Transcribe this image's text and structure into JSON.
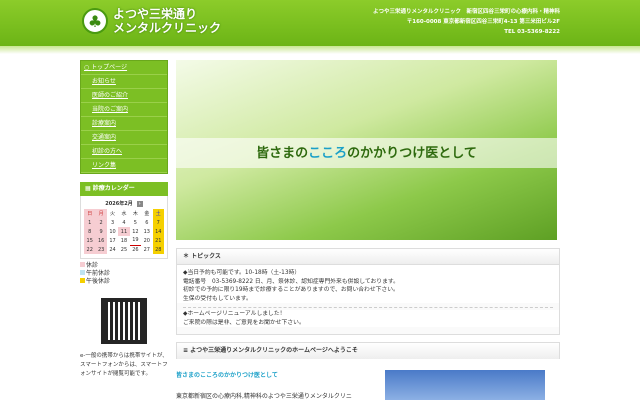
{
  "header": {
    "logo_line1": "よつや三栄通り",
    "logo_line2": "メンタルクリニック",
    "tagline": "よつや三栄通りメンタルクリニック　新宿区四谷三栄町の心療内科・精神科",
    "address": "〒160-0008 東京都新宿区四谷三栄町4-13 第三米田ビル2F",
    "tel": "TEL 03-5369-8222"
  },
  "nav": [
    "トップページ",
    "お知らせ",
    "医師のご紹介",
    "当院のご案内",
    "診療案内",
    "交通案内",
    "初診の方へ",
    "リンク集"
  ],
  "calendar": {
    "title": "診療カレンダー",
    "month": "2026年2月",
    "next": "›",
    "weekdays": [
      "日",
      "月",
      "火",
      "水",
      "木",
      "金",
      "土"
    ],
    "weeks": [
      [
        "1",
        "2",
        "3",
        "4",
        "5",
        "6",
        "7"
      ],
      [
        "8",
        "9",
        "10",
        "11",
        "12",
        "13",
        "14"
      ],
      [
        "15",
        "16",
        "17",
        "18",
        "19",
        "20",
        "21"
      ],
      [
        "22",
        "23",
        "24",
        "25",
        "26",
        "27",
        "28"
      ]
    ],
    "legend": [
      "休診",
      "午前休診",
      "午後休診"
    ],
    "colors": {
      "closed": "#f6cdd2",
      "am": "#bfe3f0",
      "pm": "#f5d000"
    }
  },
  "mobile_note": "e-一般の携帯からは携帯サイトが、スマートフォンからは、スマートフォンサイトが閲覧可能です。",
  "hero": {
    "pre": "皆さまの",
    "highlight": "こころ",
    "post": "のかかりつけ医として"
  },
  "topics": {
    "title": "トピックス",
    "lines1": [
      "◆当日予約も可能です。10-18時（土-13時）",
      "電話番号　03-5369-8222 日、月、祭休診、認知症専門外来も併設しております。",
      "初診での予約に限り19時まで診療することがありますので、お問い合わせ下さい。",
      "生保の受付もしています。"
    ],
    "lines2": [
      "◆ホームページリニューアルしました！",
      "ご来院の際は是非、ご意見をお聞かせ下さい。"
    ]
  },
  "welcome": {
    "title": "よつや三栄通りメンタルクリニックのホームページへようこそ",
    "subtitle": "皆さまのこころのかかりつけ医として",
    "text": "東京都新宿区の心療内科,精神科のよつや三栄通りメンタルクリニ"
  }
}
